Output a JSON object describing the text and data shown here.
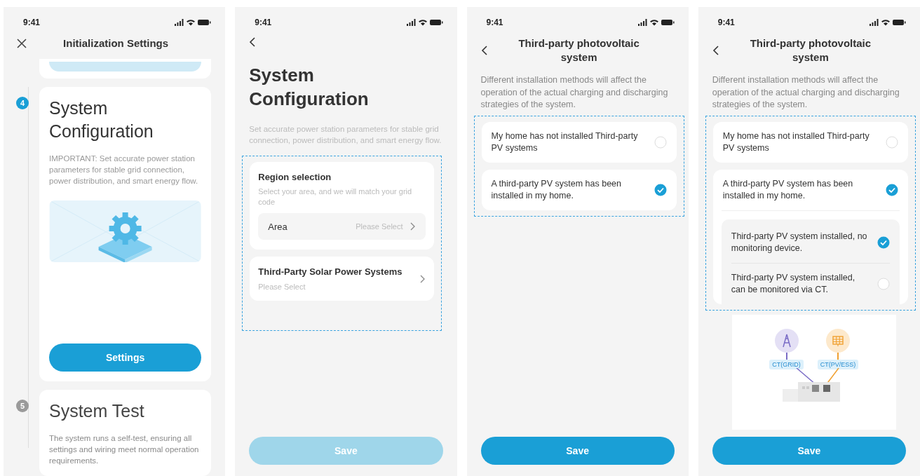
{
  "screens": [
    {
      "kind": "steps",
      "status_time": "9:41",
      "title": "Initialization Settings",
      "steps": [
        {
          "number": "4",
          "active": true,
          "title": "System Configuration",
          "description": "IMPORTANT: Set accurate power station parameters for stable grid connection, power distribution, and smart energy flow.",
          "button": "Settings"
        },
        {
          "number": "5",
          "active": false,
          "title": "System Test",
          "description": "The system runs a self-test, ensuring all settings and wiring meet normal operation requirements."
        }
      ]
    },
    {
      "kind": "config",
      "status_time": "9:41",
      "title": "System Configuration",
      "description": "Set accurate power station parameters for stable grid connection, power distribution, and smart energy flow.",
      "region": {
        "title": "Region selection",
        "hint": "Select your area, and we will match your grid code",
        "field_label": "Area",
        "field_value": "Please Select"
      },
      "solar": {
        "title": "Third-Party Solar Power Systems",
        "value": "Please Select"
      },
      "save": {
        "label": "Save",
        "disabled": true
      }
    },
    {
      "kind": "options",
      "status_time": "9:41",
      "title": "Third-party photovoltaic system",
      "description": "Different installation methods will affect the operation of the actual charging and discharging strategies of the system.",
      "options": [
        {
          "label": "My home has not installed Third-party PV systems",
          "selected": false
        },
        {
          "label": "A third-party PV system has been installed in my home.",
          "selected": true
        }
      ],
      "save": {
        "label": "Save",
        "disabled": false
      }
    },
    {
      "kind": "options",
      "status_time": "9:41",
      "title": "Third-party photovoltaic system",
      "description": "Different installation methods will affect the operation of the actual charging and discharging strategies of the system.",
      "options": [
        {
          "label": "My home has not installed Third-party PV systems",
          "selected": false
        },
        {
          "label": "A third-party PV system has been installed in my home.",
          "selected": true,
          "children": [
            {
              "label": "Third-party PV system installed, no monitoring device.",
              "selected": true
            },
            {
              "label": "Third-party PV system installed, can be monitored via CT.",
              "selected": false
            }
          ]
        }
      ],
      "diagram": {
        "grid_label": "CT(GRID)",
        "pv_label": "CT(PV/ESS)"
      },
      "save": {
        "label": "Save",
        "disabled": false
      }
    }
  ]
}
